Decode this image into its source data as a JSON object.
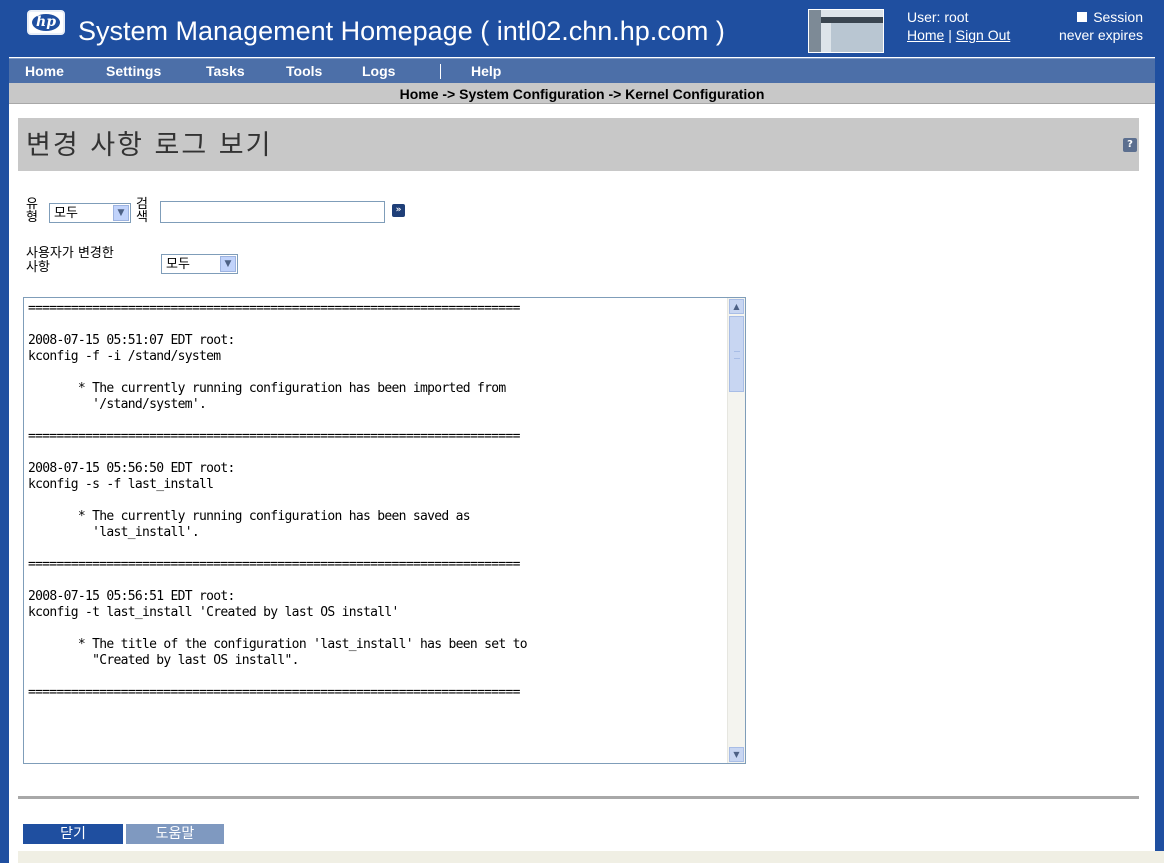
{
  "header": {
    "logo_text": "hp",
    "app_title": "System Management Homepage ( intl02.chn.hp.com )",
    "user_label": "User: root",
    "home_link": "Home",
    "link_separator": " | ",
    "signout_link": "Sign Out",
    "session_line1": "Session",
    "session_line2": "never expires"
  },
  "nav": {
    "items": [
      {
        "label": "Home"
      },
      {
        "label": "Settings"
      },
      {
        "label": "Tasks"
      },
      {
        "label": "Tools"
      },
      {
        "label": "Logs"
      },
      {
        "label": "Help"
      }
    ]
  },
  "breadcrumb": "Home -> System Configuration -> Kernel Configuration",
  "page": {
    "title": "변경 사항 로그 보기",
    "help_icon": "?"
  },
  "filters": {
    "type_label_line1": "유",
    "type_label_line2": "형",
    "type_value": "모두",
    "search_label_line1": "검",
    "search_label_line2": "색",
    "search_value": "",
    "search_go": "»",
    "user_changes_label_line1": "사용자가 변경한",
    "user_changes_label_line2": "사항",
    "user_changes_value": "모두"
  },
  "log": {
    "lines": [
      "=====================================================================",
      "",
      "2008-07-15 05:51:07 EDT root:",
      "kconfig -f -i /stand/system",
      "",
      "       * The currently running configuration has been imported from",
      "         '/stand/system'.",
      "",
      "=====================================================================",
      "",
      "2008-07-15 05:56:50 EDT root:",
      "kconfig -s -f last_install",
      "",
      "       * The currently running configuration has been saved as",
      "         'last_install'.",
      "",
      "=====================================================================",
      "",
      "2008-07-15 05:56:51 EDT root:",
      "kconfig -t last_install 'Created by last OS install'",
      "",
      "       * The title of the configuration 'last_install' has been set to",
      "         \"Created by last OS install\".",
      "",
      "====================================================================="
    ]
  },
  "buttons": {
    "close_label": "닫기",
    "help_label": "도움말"
  },
  "colors": {
    "brand_blue": "#1f4fa0",
    "nav_blue": "#4c6fa8",
    "title_gray": "#c8c8c8"
  },
  "icons": {
    "logo": "hp-logo-icon",
    "help": "help-icon",
    "go": "go-arrow-icon",
    "dropdown": "chevron-down-icon"
  }
}
